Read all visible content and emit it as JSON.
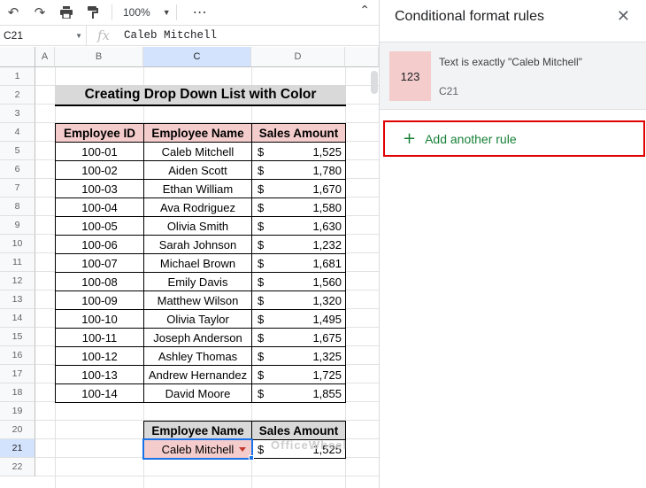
{
  "toolbar": {
    "undo_icon": "undo-icon",
    "redo_icon": "redo-icon",
    "print_icon": "print-icon",
    "paint_format_icon": "paint-format-icon",
    "zoom": "100%",
    "more": "⋮",
    "collapse_icon": "chevron-up-icon"
  },
  "formula_bar": {
    "cell_ref": "C21",
    "fx": "fx",
    "value": "Caleb Mitchell"
  },
  "columns": [
    "A",
    "B",
    "C",
    "D"
  ],
  "rows": [
    "1",
    "2",
    "3",
    "4",
    "5",
    "6",
    "7",
    "8",
    "9",
    "10",
    "11",
    "12",
    "13",
    "14",
    "15",
    "16",
    "17",
    "18",
    "19",
    "20",
    "21",
    "22"
  ],
  "sheet": {
    "title": "Creating Drop Down List with Color",
    "headers": [
      "Employee ID",
      "Employee Name",
      "Sales Amount"
    ],
    "currency": "$",
    "data": [
      [
        "100-01",
        "Caleb Mitchell",
        "1,525"
      ],
      [
        "100-02",
        "Aiden Scott",
        "1,780"
      ],
      [
        "100-03",
        "Ethan William",
        "1,670"
      ],
      [
        "100-04",
        "Ava Rodriguez",
        "1,580"
      ],
      [
        "100-05",
        "Olivia Smith",
        "1,630"
      ],
      [
        "100-06",
        "Sarah Johnson",
        "1,232"
      ],
      [
        "100-07",
        "Michael Brown",
        "1,681"
      ],
      [
        "100-08",
        "Emily Davis",
        "1,560"
      ],
      [
        "100-09",
        "Matthew Wilson",
        "1,320"
      ],
      [
        "100-10",
        "Olivia Taylor",
        "1,495"
      ],
      [
        "100-11",
        "Joseph Anderson",
        "1,675"
      ],
      [
        "100-12",
        "Ashley Thomas",
        "1,325"
      ],
      [
        "100-13",
        "Andrew Hernandez",
        "1,725"
      ],
      [
        "100-14",
        "David Moore",
        "1,855"
      ]
    ],
    "lookup_headers": [
      "Employee Name",
      "Sales Amount"
    ],
    "lookup_name": "Caleb Mitchell",
    "lookup_amount": "1,525",
    "watermark": "OfficeWheel"
  },
  "panel": {
    "title": "Conditional format rules",
    "close_icon": "close-icon",
    "rule_preview": "123",
    "rule_description": "Text is exactly \"Caleb Mitchell\"",
    "rule_range": "C21",
    "add_rule_label": "Add another rule",
    "add_rule_icon": "+"
  },
  "colors": {
    "header_fill": "#f4cccc",
    "title_fill": "#d9d9d9",
    "selection": "#1a73e8",
    "add_rule_text": "#188038",
    "highlight_border": "#e00000"
  }
}
